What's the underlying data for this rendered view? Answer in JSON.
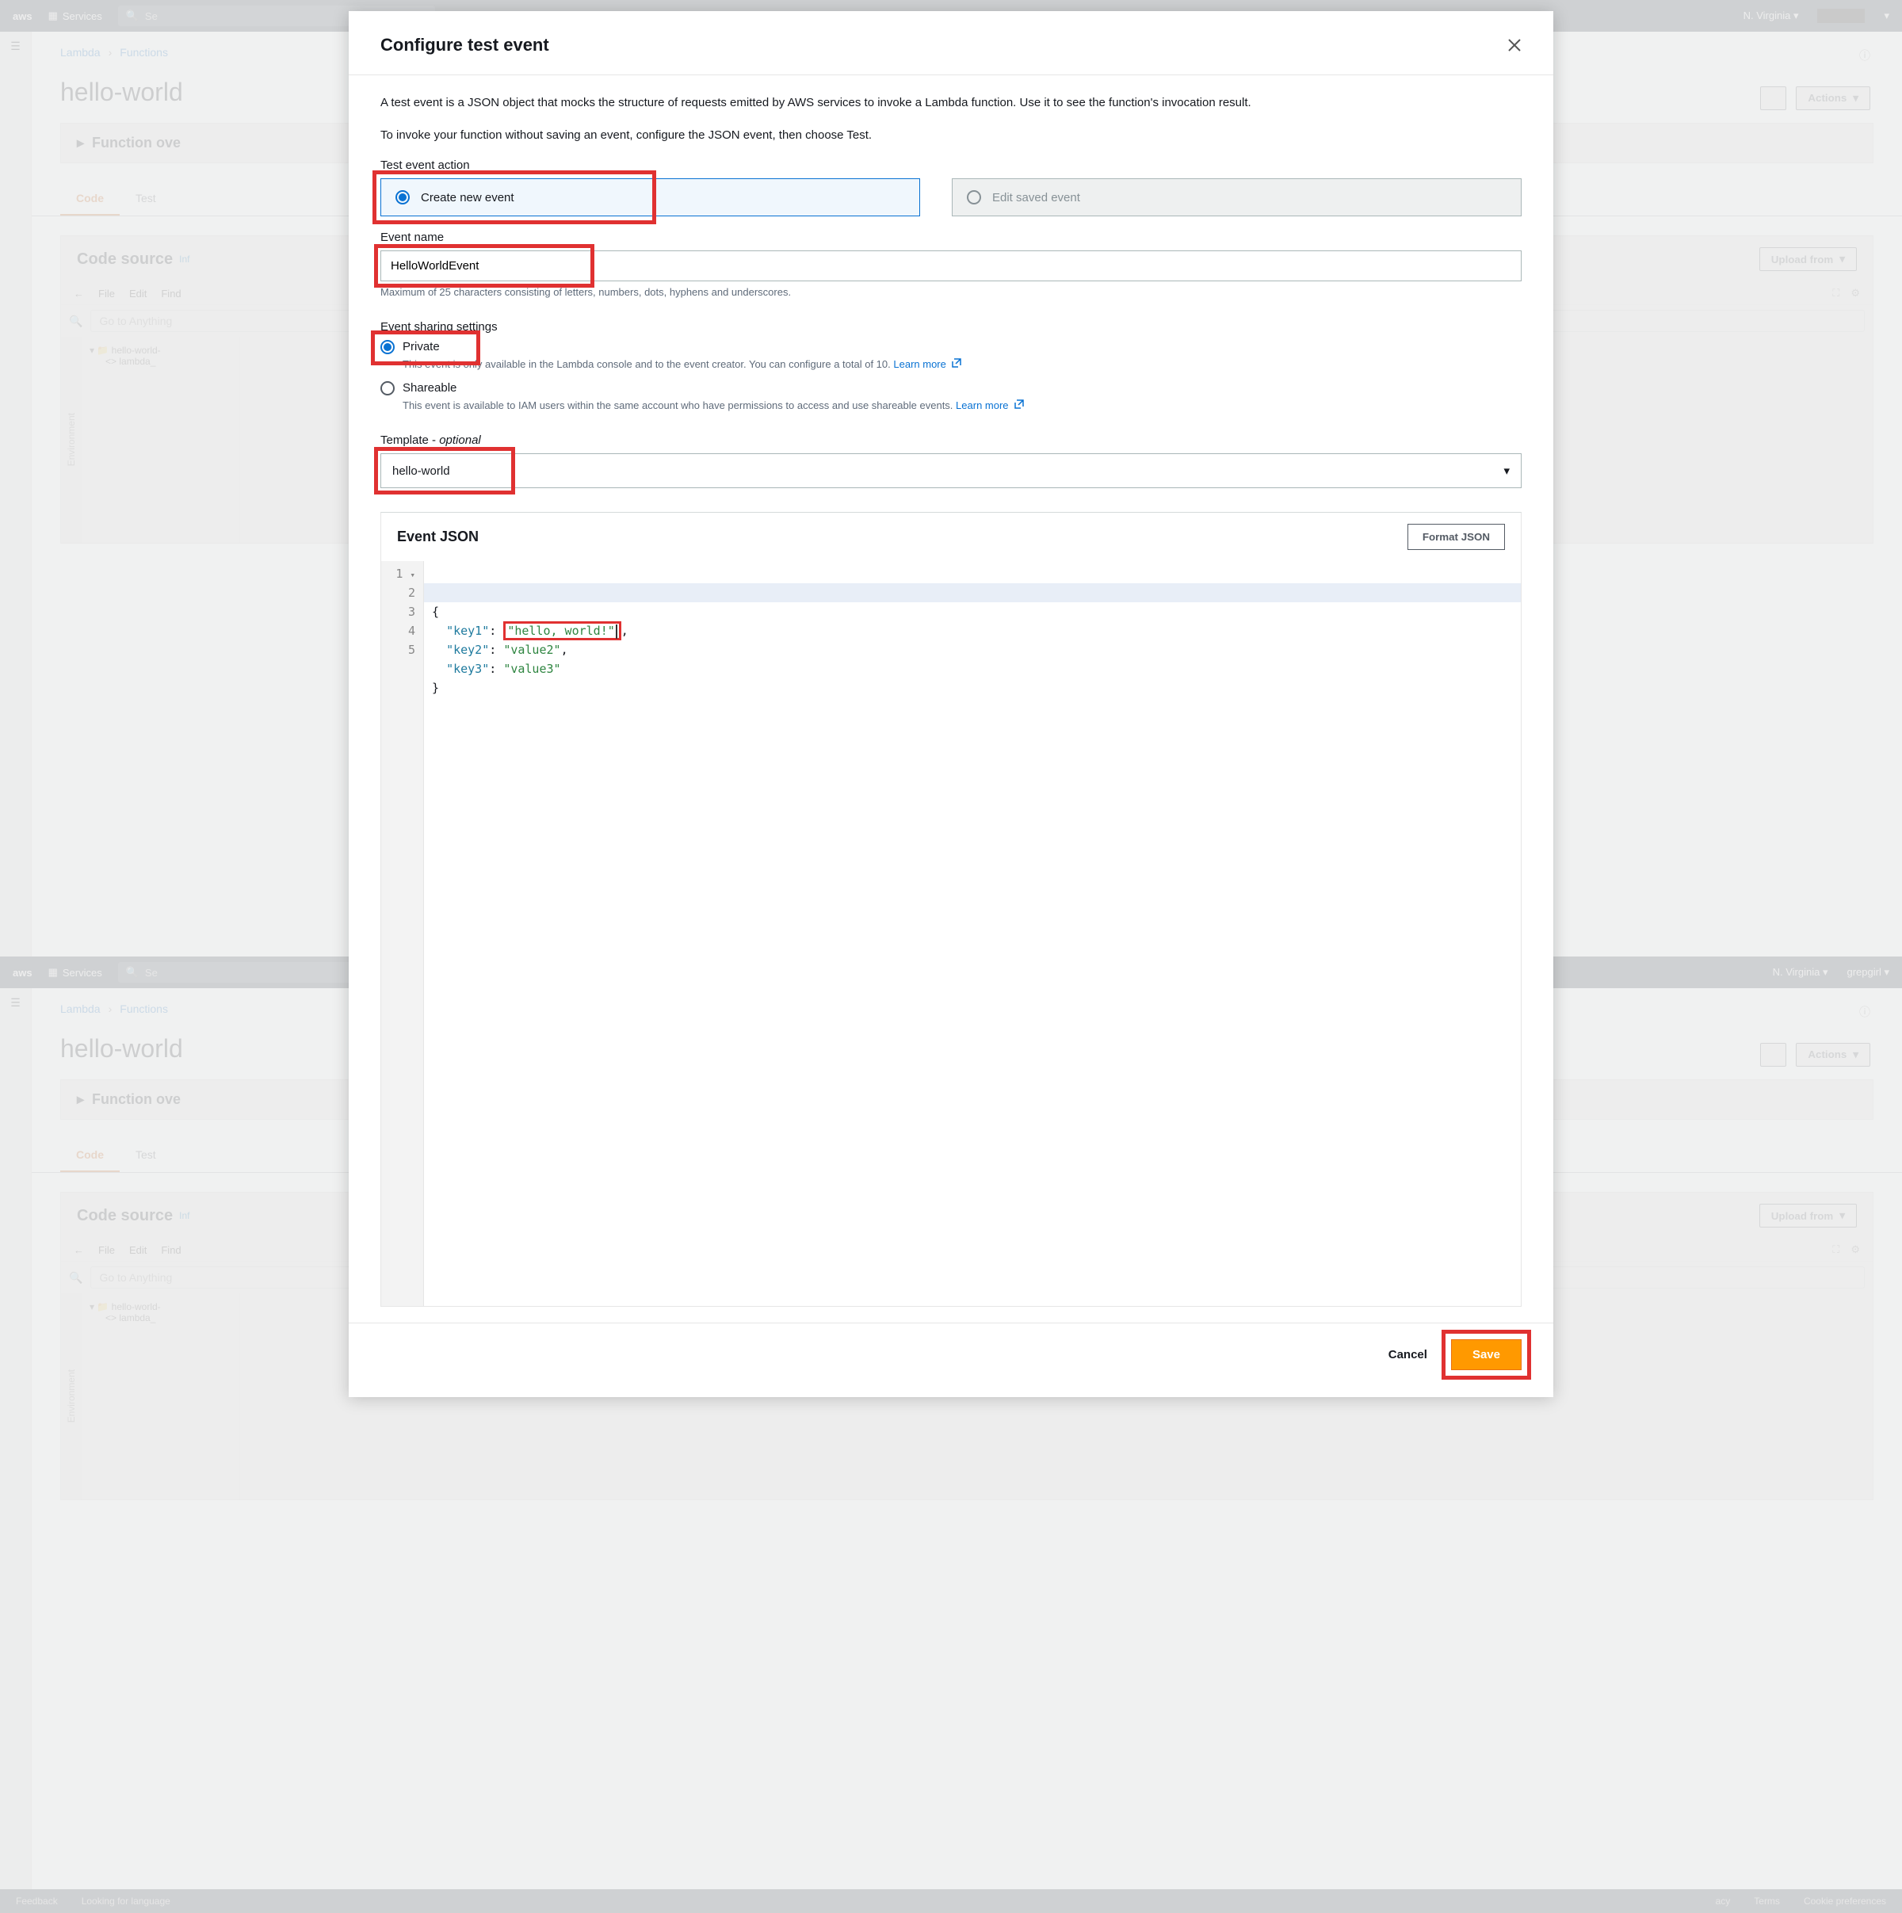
{
  "topbar": {
    "aws": "aws",
    "services": "Services",
    "search_placeholder": "Se",
    "region": "N. Virginia",
    "region2": "N. Virginia",
    "user2": "grepgirl"
  },
  "breadcrumb": {
    "a": "Lambda",
    "b": "Functions"
  },
  "page_title": "hello-world",
  "panel_overview": "Function ove",
  "tabs": {
    "code": "Code",
    "test": "Test"
  },
  "code_source": {
    "title": "Code source",
    "info": "Inf",
    "upload": "Upload from"
  },
  "ide": {
    "menu": {
      "file": "File",
      "edit": "Edit",
      "find": "Find"
    },
    "left_arrow": "←",
    "search_placeholder": "Go to Anything",
    "side_tab": "Environment",
    "tree_root": "hello-world-",
    "tree_file": "lambda_"
  },
  "footer": {
    "feedback": "Feedback",
    "lang": "Looking for language",
    "privacy": "acy",
    "terms": "Terms",
    "cookies": "Cookie preferences"
  },
  "modal": {
    "title": "Configure test event",
    "desc1": "A test event is a JSON object that mocks the structure of requests emitted by AWS services to invoke a Lambda function. Use it to see the function's invocation result.",
    "desc2": "To invoke your function without saving an event, configure the JSON event, then choose Test.",
    "action_label": "Test event action",
    "create_new": "Create new event",
    "edit_saved": "Edit saved event",
    "event_name_label": "Event name",
    "event_name_value": "HelloWorldEvent",
    "event_name_help": "Maximum of 25 characters consisting of letters, numbers, dots, hyphens and underscores.",
    "sharing_label": "Event sharing settings",
    "private": "Private",
    "private_desc": "This event is only available in the Lambda console and to the event creator. You can configure a total of 10.",
    "shareable": "Shareable",
    "shareable_desc": "This event is available to IAM users within the same account who have permissions to access and use shareable events.",
    "learn_more": "Learn more",
    "template_label_a": "Template - ",
    "template_label_b": "optional",
    "template_value": "hello-world",
    "json_title": "Event JSON",
    "format_json": "Format JSON",
    "cancel": "Cancel",
    "save": "Save"
  },
  "editor": {
    "line1": "{",
    "k1": "\"key1\"",
    "v1": "\"hello, world!\"",
    "k2": "\"key2\"",
    "v2": "\"value2\"",
    "k3": "\"key3\"",
    "v3": "\"value3\"",
    "line5": "}"
  },
  "actions_btn": "Actions"
}
